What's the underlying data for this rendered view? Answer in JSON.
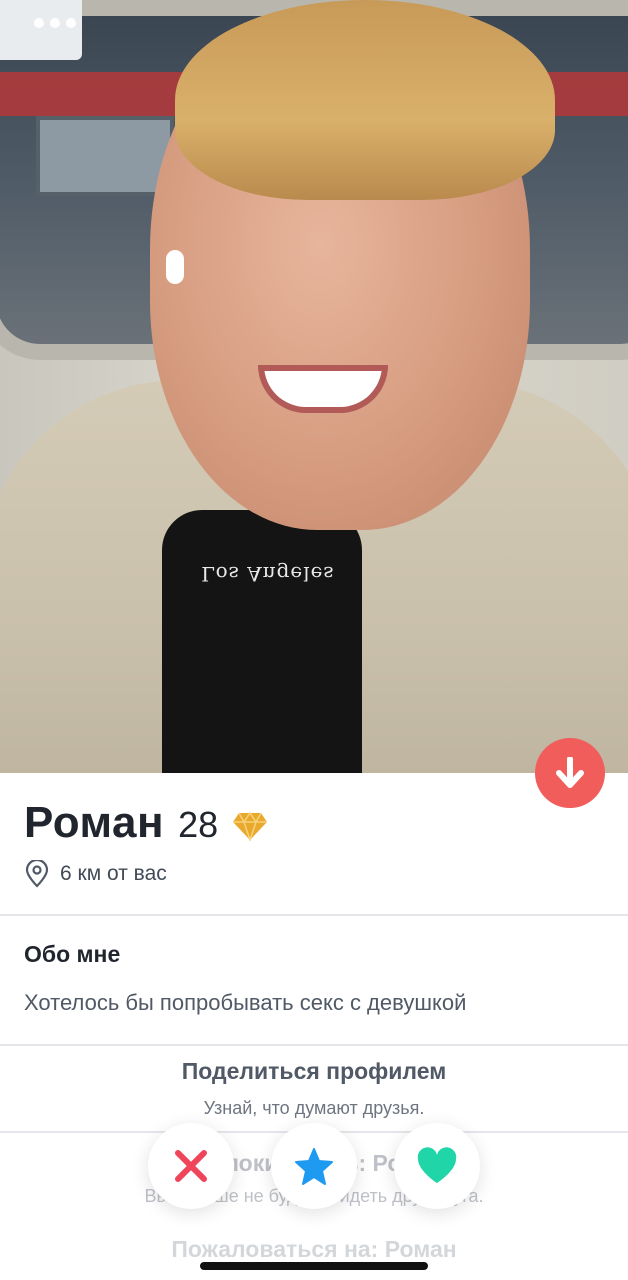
{
  "profile": {
    "name": "Роман",
    "age": "28",
    "distance": "6 км от вас",
    "photo_description_icon": "profile-photo",
    "shirt_print": "Los Angeles"
  },
  "about": {
    "title": "Обо мне",
    "text": "Хотелось бы попробывать секс с девушкой"
  },
  "share": {
    "title": "Поделиться профилем",
    "subtitle": "Узнай, что думают друзья."
  },
  "block": {
    "title": "Заблокировать: Роман",
    "subtitle": "Вы больше не будете видеть друг друга."
  },
  "report": {
    "title": "Пожаловаться на: Роман"
  },
  "actions": {
    "nope_icon": "x-icon",
    "superlike_icon": "star-icon",
    "like_icon": "heart-icon"
  },
  "colors": {
    "accent": "#f05d5a",
    "nope": "#f0445a",
    "superlike": "#1e9bf0",
    "like": "#20d5a8",
    "gem": "#e9a92c"
  }
}
